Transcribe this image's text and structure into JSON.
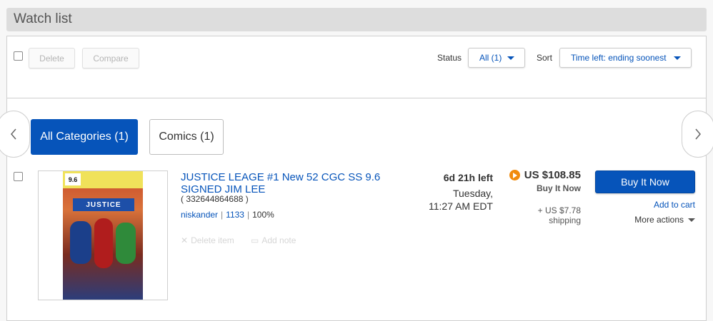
{
  "header": {
    "title": "Watch list"
  },
  "toolbar": {
    "delete_label": "Delete",
    "compare_label": "Compare",
    "status_label": "Status",
    "status_value": "All (1)",
    "sort_label": "Sort",
    "sort_value": "Time left: ending soonest"
  },
  "categories": {
    "items": [
      {
        "label": "All Categories (1)",
        "active": true
      },
      {
        "label": "Comics (1)",
        "active": false
      }
    ]
  },
  "listing": {
    "title": "JUSTICE LEAGE #1 New 52 CGC SS 9.6 SIGNED JIM LEE",
    "item_id": "( 332644864688 )",
    "seller": "niskander",
    "feedback": "1133",
    "positive": "100%",
    "delete_label": "Delete item",
    "note_label": "Add note",
    "time_left": "6d 21h left",
    "end_day": "Tuesday,",
    "end_time": "11:27 AM EDT",
    "price": "US $108.85",
    "format": "Buy It Now",
    "shipping_cost": "+ US $7.78",
    "shipping_label": "shipping",
    "buy_label": "Buy It Now",
    "cart_label": "Add to cart",
    "more_label": "More actions",
    "comic_grade": "9.6",
    "comic_logo": "JUSTICE"
  },
  "colors": {
    "accent": "#0654ba",
    "buy_icon": "#f18b0d"
  },
  "icons": [
    "chevron-left-icon",
    "chevron-right-icon",
    "caret-down-icon",
    "play-icon",
    "close-icon",
    "note-icon"
  ]
}
